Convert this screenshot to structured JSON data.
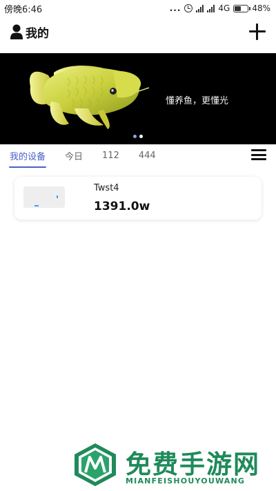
{
  "status_bar": {
    "time": "傍晚6:46",
    "dots": "...",
    "network": "4G",
    "battery": "48%",
    "battery_level": 0.48
  },
  "header": {
    "title": "我的",
    "user_icon": "user-icon",
    "add_icon": "plus-icon"
  },
  "banner": {
    "slogan": "懂养鱼，更懂光",
    "slide_count": 2,
    "active_slide": 0
  },
  "tabs": {
    "items": [
      {
        "label": "我的设备",
        "active": true
      },
      {
        "label": "今日",
        "active": false
      },
      {
        "label": "112",
        "active": false
      },
      {
        "label": "444",
        "active": false
      }
    ],
    "menu_icon": "hamburger-menu-icon"
  },
  "devices": [
    {
      "name": "Twst4",
      "value": "1391.0w"
    }
  ],
  "watermark": {
    "title": "免费手游网",
    "subtitle": "MIANFEISHOUYOUWANG"
  },
  "colors": {
    "accent": "#4a5fc8",
    "banner_bg": "#000000",
    "watermark": "#1f8a5a"
  }
}
